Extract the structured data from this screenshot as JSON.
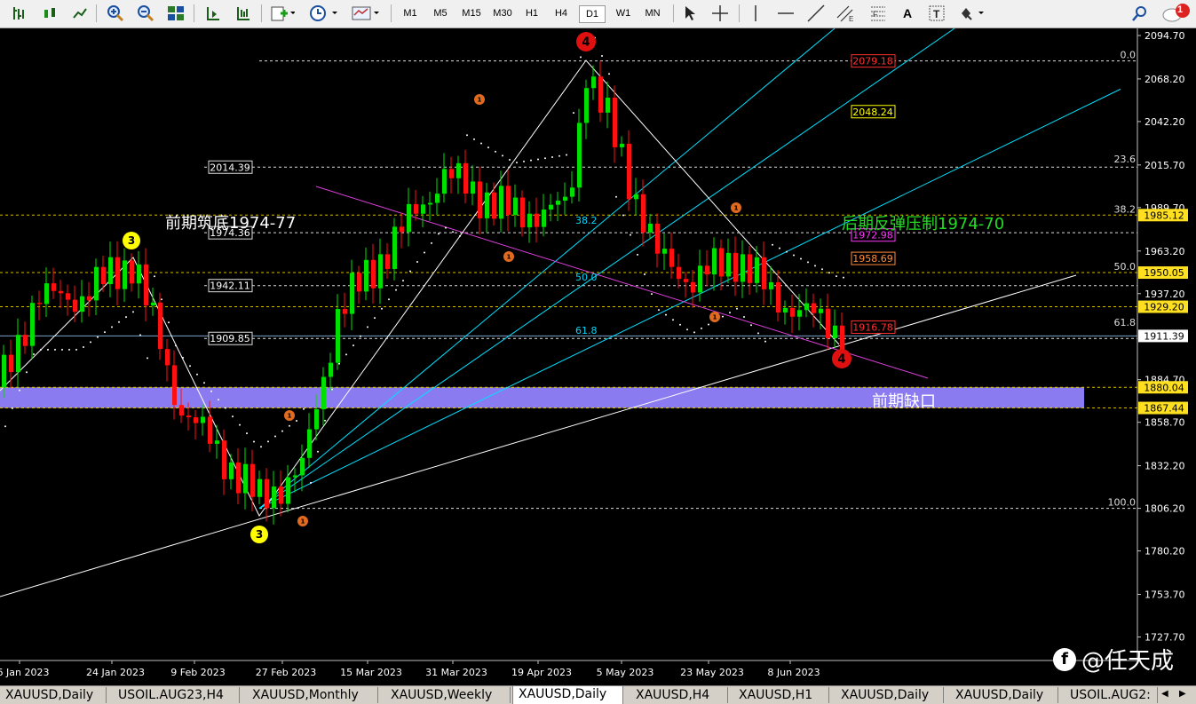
{
  "toolbar": {
    "timeframes": [
      "M1",
      "M5",
      "M15",
      "M30",
      "H1",
      "H4",
      "D1",
      "W1",
      "MN"
    ],
    "active_timeframe": "D1",
    "text_tool": "A",
    "notification_count": "1",
    "tools": [
      "bar-chart-icon",
      "candle-chart-icon",
      "line-chart-icon",
      "zoom-in-icon",
      "zoom-out-icon",
      "tile-windows-icon",
      "chart-shift-icon",
      "autoscroll-icon",
      "new-order-icon",
      "history-clock-icon",
      "indicator-icon",
      "cursor-icon",
      "crosshair-icon",
      "vertical-line-icon",
      "horizontal-line-icon",
      "trendline-icon",
      "fibo-icon",
      "text-label-icon",
      "shapes-icon",
      "search-icon",
      "chat-icon"
    ]
  },
  "chart": {
    "symbol": "XAUUSD",
    "timeframe": "Daily",
    "current_price": "1911.39",
    "price_axis": [
      "2094.70",
      "2068.20",
      "2042.20",
      "2015.70",
      "1989.70",
      "1963.20",
      "1937.20",
      "1911.39",
      "1884.70",
      "1858.70",
      "1832.20",
      "1806.20",
      "1780.20",
      "1753.70",
      "1727.70"
    ],
    "date_axis": [
      "6 Jan 2023",
      "24 Jan 2023",
      "9 Feb 2023",
      "27 Feb 2023",
      "15 Mar 2023",
      "31 Mar 2023",
      "19 Apr 2023",
      "5 May 2023",
      "23 May 2023",
      "8 Jun 2023"
    ],
    "fib_right_labels": [
      "0.0",
      "23.6",
      "38.2",
      "50.0",
      "61.8",
      "100.0"
    ],
    "fib_center_labels": [
      "38.2",
      "50.0",
      "61.8"
    ],
    "price_tags": [
      {
        "text": "2079.18",
        "border": "#ff3030",
        "color": "#ff3030"
      },
      {
        "text": "2048.24",
        "border": "#ffff00",
        "color": "#ffff00"
      },
      {
        "text": "1972.98",
        "border": "#ff33ff",
        "color": "#ff33ff"
      },
      {
        "text": "1958.69",
        "border": "#ff8c3a",
        "color": "#ff8c3a"
      },
      {
        "text": "1916.78",
        "border": "#ff3030",
        "color": "#ff3030"
      }
    ],
    "axis_tags": [
      {
        "text": "1985.12",
        "bg": "#ffe020"
      },
      {
        "text": "1950.05",
        "bg": "#ffe020"
      },
      {
        "text": "1929.20",
        "bg": "#ffe020"
      },
      {
        "text": "1880.04",
        "bg": "#ffe020"
      },
      {
        "text": "1867.44",
        "bg": "#ffe020"
      }
    ],
    "left_level_labels": [
      "2014.39",
      "1974.36",
      "1942.11",
      "1909.85"
    ],
    "annotations": {
      "support_note": "前期筑底1974-77",
      "resistance_note": "后期反弹压制1974-70",
      "gap_note": "前期缺口"
    },
    "wave_labels": {
      "wave3_top": "3",
      "wave3_bottom": "3",
      "wave4_top": "4",
      "wave4_bottom": "4",
      "sub_wave": "1"
    },
    "colors": {
      "bull": "#00e000",
      "bear": "#ff1010",
      "gap_zone": "#8a7cf0",
      "fan": "#00e0ff",
      "channel": "#e040e0"
    }
  },
  "tabs": [
    {
      "label": "XAUUSD,Daily",
      "active": false
    },
    {
      "label": "USOIL.AUG23,H4",
      "active": false
    },
    {
      "label": "XAUUSD,Monthly",
      "active": false
    },
    {
      "label": "XAUUSD,Weekly",
      "active": false
    },
    {
      "label": "XAUUSD,Daily",
      "active": true
    },
    {
      "label": "XAUUSD,H4",
      "active": false
    },
    {
      "label": "XAUUSD,H1",
      "active": false
    },
    {
      "label": "XAUUSD,Daily",
      "active": false
    },
    {
      "label": "XAUUSD,Daily",
      "active": false
    },
    {
      "label": "USOIL.AUG2:",
      "active": false
    }
  ],
  "watermark": {
    "logo": "f",
    "text": "@任天成"
  }
}
